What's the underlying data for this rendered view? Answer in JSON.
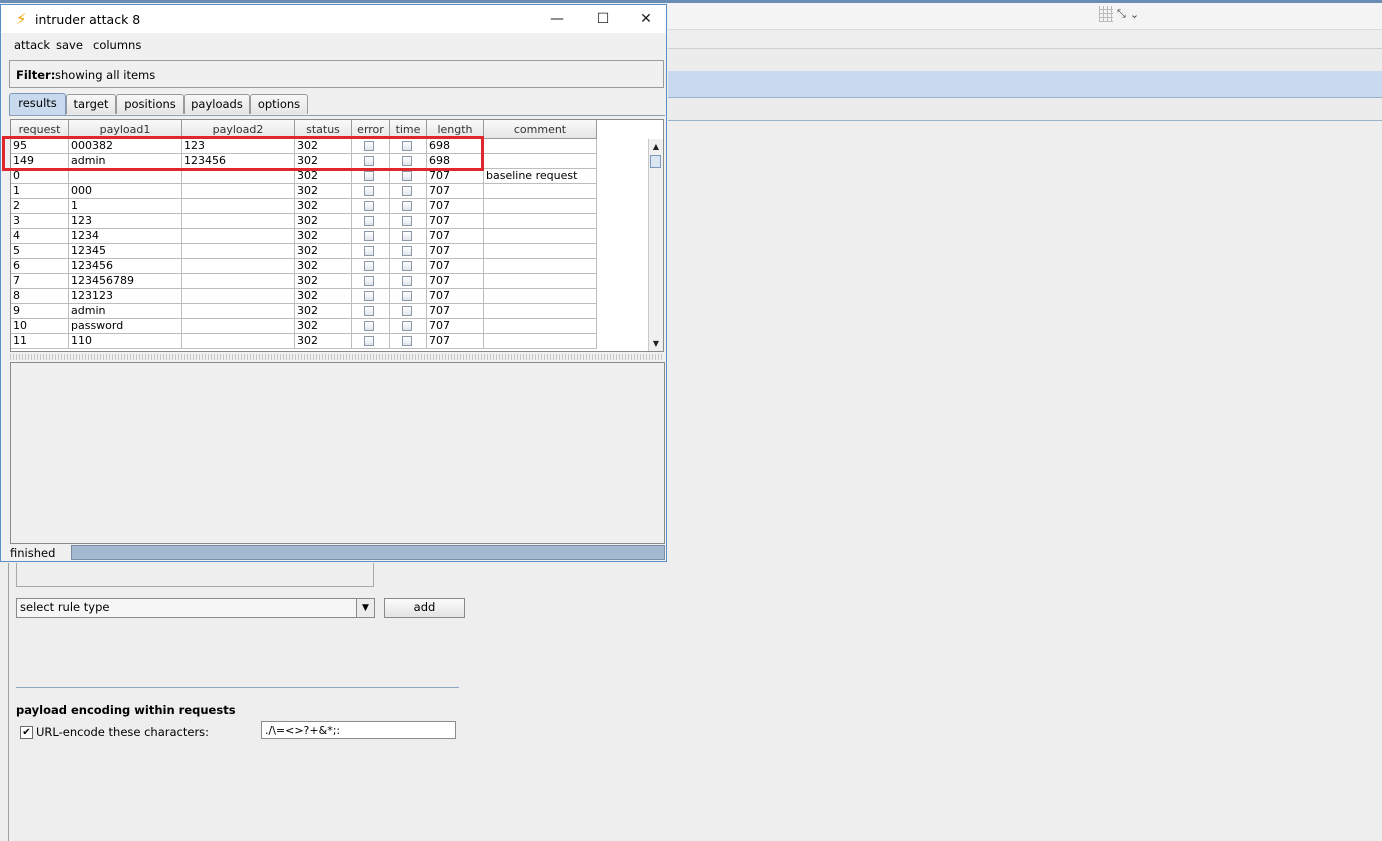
{
  "window": {
    "title": "intruder attack 8",
    "icon": "lightning-icon",
    "controls": {
      "minimize": "—",
      "maximize": "☐",
      "close": "✕"
    }
  },
  "menu": [
    "attack",
    "save",
    "columns"
  ],
  "filter": {
    "label": "Filter:",
    "text": "showing all items"
  },
  "tabs": [
    {
      "label": "results",
      "active": true
    },
    {
      "label": "target",
      "active": false
    },
    {
      "label": "positions",
      "active": false
    },
    {
      "label": "payloads",
      "active": false
    },
    {
      "label": "options",
      "active": false
    }
  ],
  "table": {
    "columns": [
      "request",
      "payload1",
      "payload2",
      "status",
      "error",
      "time",
      "length",
      "comment"
    ],
    "rows": [
      [
        "95",
        "000382",
        "123",
        "302",
        "",
        "",
        "698",
        ""
      ],
      [
        "149",
        "admin",
        "123456",
        "302",
        "",
        "",
        "698",
        ""
      ],
      [
        "0",
        "",
        "",
        "302",
        "",
        "",
        "707",
        "baseline request"
      ],
      [
        "1",
        "000",
        "",
        "302",
        "",
        "",
        "707",
        ""
      ],
      [
        "2",
        "1",
        "",
        "302",
        "",
        "",
        "707",
        ""
      ],
      [
        "3",
        "123",
        "",
        "302",
        "",
        "",
        "707",
        ""
      ],
      [
        "4",
        "1234",
        "",
        "302",
        "",
        "",
        "707",
        ""
      ],
      [
        "5",
        "12345",
        "",
        "302",
        "",
        "",
        "707",
        ""
      ],
      [
        "6",
        "123456",
        "",
        "302",
        "",
        "",
        "707",
        ""
      ],
      [
        "7",
        "123456789",
        "",
        "302",
        "",
        "",
        "707",
        ""
      ],
      [
        "8",
        "123123",
        "",
        "302",
        "",
        "",
        "707",
        ""
      ],
      [
        "9",
        "admin",
        "",
        "302",
        "",
        "",
        "707",
        ""
      ],
      [
        "10",
        "password",
        "",
        "302",
        "",
        "",
        "707",
        ""
      ],
      [
        "11",
        "110",
        "",
        "302",
        "",
        "",
        "707",
        ""
      ]
    ],
    "highlight_color": "#e0282c"
  },
  "status": {
    "text": "finished",
    "progress": 1.0
  },
  "background": {
    "rule_select": "select rule type",
    "add_button": "add",
    "encoding_heading": "payload encoding within requests",
    "url_encode_label": "URL-encode these characters:",
    "url_encode_checked": true,
    "url_encode_chars": "./\\=<>?+&*;:"
  }
}
